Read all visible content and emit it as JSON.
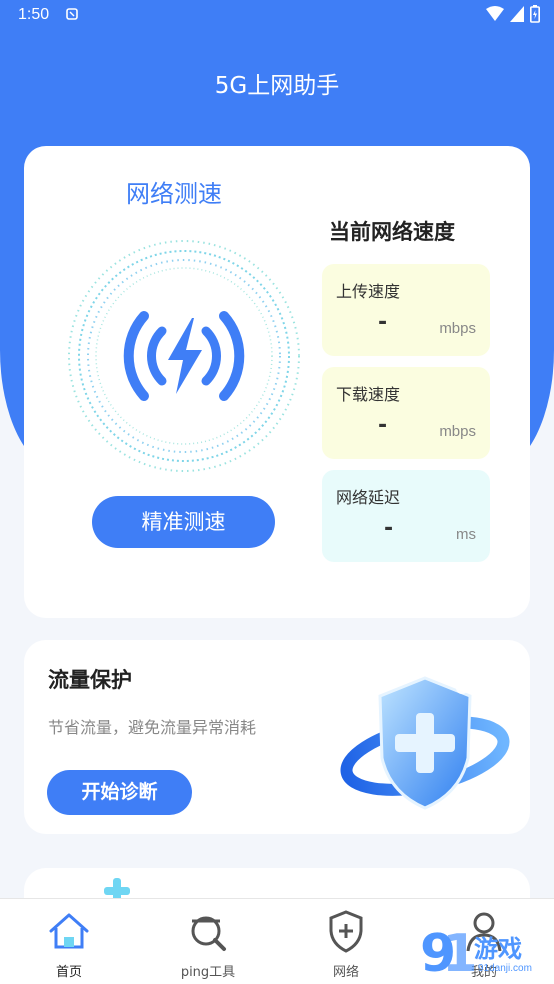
{
  "status": {
    "time": "1:50"
  },
  "app": {
    "title": "5G上网助手"
  },
  "speed_card": {
    "title": "网络测速",
    "test_button": "精准测速",
    "current_title": "当前网络速度",
    "stats": [
      {
        "label": "上传速度",
        "value": "-",
        "unit": "mbps"
      },
      {
        "label": "下载速度",
        "value": "-",
        "unit": "mbps"
      },
      {
        "label": "网络延迟",
        "value": "-",
        "unit": "ms"
      }
    ]
  },
  "protect_card": {
    "title": "流量保护",
    "description": "节省流量，避免流量异常消耗",
    "button": "开始诊断"
  },
  "tabs": [
    {
      "label": "首页",
      "icon": "home-icon",
      "active": true
    },
    {
      "label": "ping工具",
      "icon": "search-icon",
      "active": false
    },
    {
      "label": "网络",
      "icon": "shield-plus-icon",
      "active": false
    },
    {
      "label": "我的",
      "icon": "person-icon",
      "active": false
    }
  ],
  "watermark": {
    "text": "游戏",
    "number": "9",
    "site": "91danji.com"
  },
  "colors": {
    "primary": "#3f7ef6",
    "yellow_box": "#fbfde0",
    "cyan_box": "#e8fbfb"
  }
}
